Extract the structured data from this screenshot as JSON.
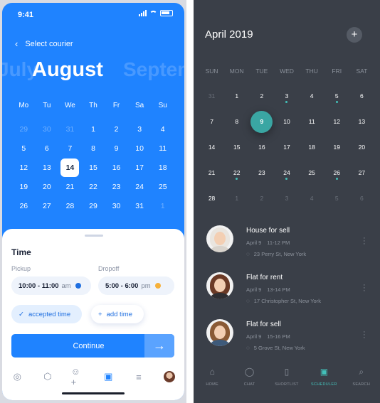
{
  "left": {
    "status_time": "9:41",
    "header_title": "Select courier",
    "month_prev": "July",
    "month_current": "August",
    "month_next": "September",
    "weekdays": [
      "Mo",
      "Tu",
      "We",
      "Th",
      "Fr",
      "Sa",
      "Su"
    ],
    "weeks": [
      [
        {
          "d": "29",
          "dim": true
        },
        {
          "d": "30",
          "dim": true
        },
        {
          "d": "31",
          "dim": true
        },
        {
          "d": "1"
        },
        {
          "d": "2"
        },
        {
          "d": "3"
        },
        {
          "d": "4"
        }
      ],
      [
        {
          "d": "5"
        },
        {
          "d": "6"
        },
        {
          "d": "7"
        },
        {
          "d": "8"
        },
        {
          "d": "9"
        },
        {
          "d": "10"
        },
        {
          "d": "11"
        }
      ],
      [
        {
          "d": "12"
        },
        {
          "d": "13"
        },
        {
          "d": "14",
          "selected": true
        },
        {
          "d": "15"
        },
        {
          "d": "16"
        },
        {
          "d": "17"
        },
        {
          "d": "18"
        }
      ],
      [
        {
          "d": "19"
        },
        {
          "d": "20"
        },
        {
          "d": "21"
        },
        {
          "d": "22"
        },
        {
          "d": "23"
        },
        {
          "d": "24"
        },
        {
          "d": "25"
        }
      ],
      [
        {
          "d": "26"
        },
        {
          "d": "27"
        },
        {
          "d": "28"
        },
        {
          "d": "29"
        },
        {
          "d": "30"
        },
        {
          "d": "31"
        },
        {
          "d": "1",
          "dim": true
        }
      ]
    ],
    "sheet": {
      "title": "Time",
      "pickup_label": "Pickup",
      "pickup_value": "10:00 - 11:00",
      "pickup_ampm": "am",
      "pickup_dot_color": "#1f6fe0",
      "dropoff_label": "Dropoff",
      "dropoff_value": "5:00 - 6:00",
      "dropoff_ampm": "pm",
      "dropoff_dot_color": "#f6b13b",
      "accepted_label": "accepted time",
      "add_label": "add time",
      "continue_label": "Continue"
    },
    "tabs": [
      "compass-icon",
      "box-icon",
      "add-user-icon",
      "calendar-icon",
      "menu-icon",
      "avatar"
    ],
    "active_tab": "calendar-icon",
    "accent": "#1f83ff"
  },
  "right": {
    "title": "April 2019",
    "weekdays": [
      "SUN",
      "MON",
      "TUE",
      "WED",
      "THU",
      "FRI",
      "SAT"
    ],
    "weeks": [
      [
        {
          "d": "31",
          "dim": true
        },
        {
          "d": "1"
        },
        {
          "d": "2"
        },
        {
          "d": "3",
          "dot": true
        },
        {
          "d": "4"
        },
        {
          "d": "5",
          "dot": true
        },
        {
          "d": "6"
        }
      ],
      [
        {
          "d": "7"
        },
        {
          "d": "8"
        },
        {
          "d": "9",
          "selected": true
        },
        {
          "d": "10"
        },
        {
          "d": "11"
        },
        {
          "d": "12"
        },
        {
          "d": "13"
        }
      ],
      [
        {
          "d": "14"
        },
        {
          "d": "15"
        },
        {
          "d": "16"
        },
        {
          "d": "17"
        },
        {
          "d": "18"
        },
        {
          "d": "19"
        },
        {
          "d": "20"
        }
      ],
      [
        {
          "d": "21"
        },
        {
          "d": "22",
          "dot": true
        },
        {
          "d": "23"
        },
        {
          "d": "24",
          "dot": true
        },
        {
          "d": "25"
        },
        {
          "d": "26",
          "dot": true
        },
        {
          "d": "27"
        }
      ],
      [
        {
          "d": "28"
        },
        {
          "d": "1",
          "dim": true
        },
        {
          "d": "2",
          "dim": true
        },
        {
          "d": "3",
          "dim": true
        },
        {
          "d": "4",
          "dim": true
        },
        {
          "d": "5",
          "dim": true
        },
        {
          "d": "6",
          "dim": true
        }
      ]
    ],
    "listings": [
      {
        "title": "House for sell",
        "date": "April 9",
        "time": "11-12 PM",
        "address": "23 Perry St, New York"
      },
      {
        "title": "Flat for rent",
        "date": "April 9",
        "time": "13-14 PM",
        "address": "17 Christopher St, New York"
      },
      {
        "title": "Flat for sell",
        "date": "April 9",
        "time": "15-16 PM",
        "address": "5 Grove St, New York"
      }
    ],
    "tabs": [
      {
        "label": "HOME",
        "icon": "home-icon"
      },
      {
        "label": "CHAT",
        "icon": "chat-icon"
      },
      {
        "label": "SHORTLIST",
        "icon": "clipboard-icon"
      },
      {
        "label": "SCHEDULER",
        "icon": "calendar-icon"
      },
      {
        "label": "SEARCH",
        "icon": "search-icon"
      }
    ],
    "active_tab": "SCHEDULER",
    "accent": "#43c0b9"
  }
}
